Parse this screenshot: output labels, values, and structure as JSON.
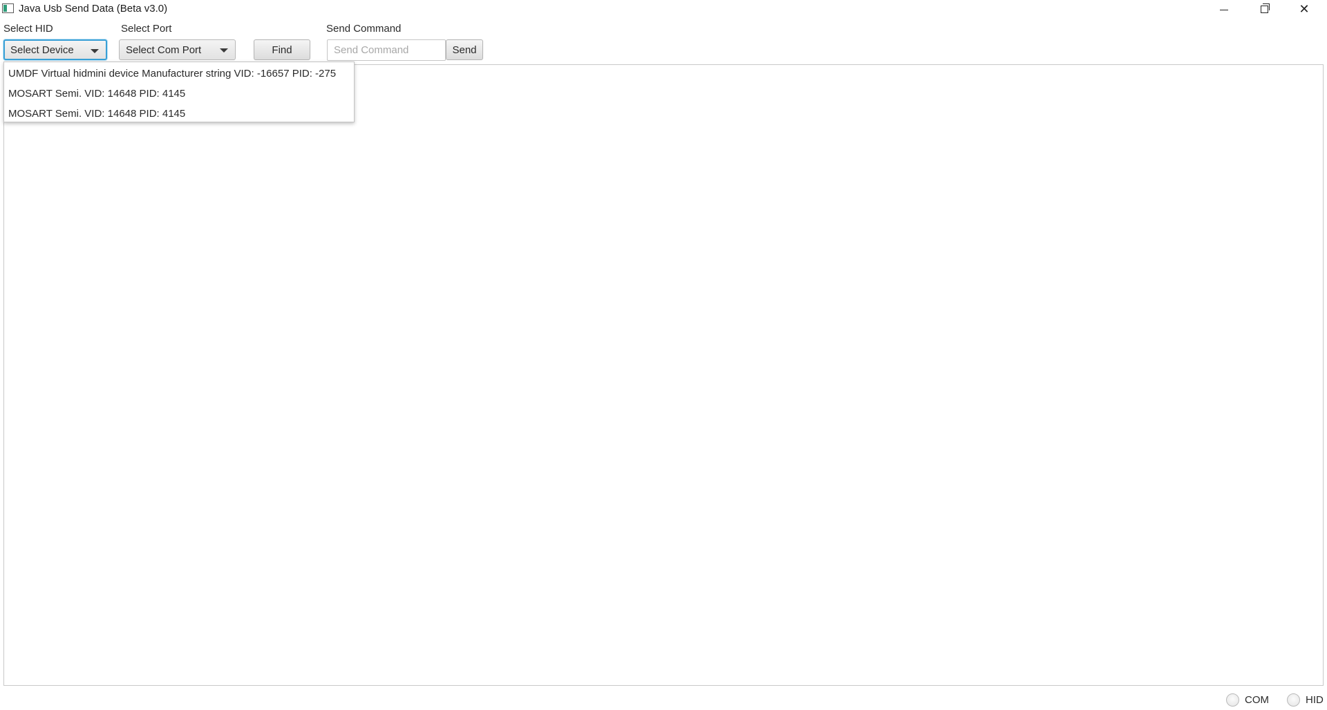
{
  "window": {
    "title": "Java Usb Send Data (Beta v3.0)",
    "controls": [
      "minimize",
      "restore",
      "close"
    ]
  },
  "toolbar": {
    "hid_label": "Select HID",
    "hid_combo_value": "Select Device",
    "port_label": "Select Port",
    "port_combo_value": "Select Com Port",
    "find_label": "Find",
    "command_label": "Send Command",
    "command_placeholder": "Send Command",
    "command_value": "",
    "send_label": "Send"
  },
  "hid_dropdown": {
    "open": true,
    "items": [
      "UMDF Virtual hidmini device Manufacturer string VID: -16657 PID: -275",
      "MOSART Semi. VID: 14648 PID: 4145",
      "MOSART Semi. VID: 14648 PID: 4145"
    ]
  },
  "output": {
    "text": ""
  },
  "mode": {
    "options": [
      {
        "label": "COM",
        "selected": false
      },
      {
        "label": "HID",
        "selected": false
      }
    ]
  },
  "colors": {
    "focus_accent": "#39a0d6",
    "background": "#ffffff"
  }
}
